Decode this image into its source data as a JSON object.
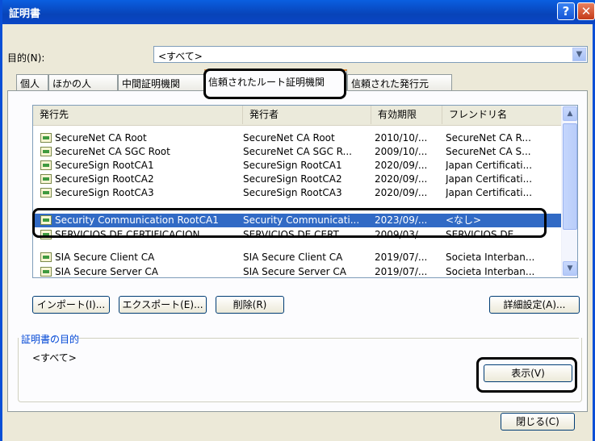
{
  "window": {
    "title": "証明書",
    "help_glyph": "?",
    "close_glyph": "✕"
  },
  "purpose": {
    "label": "目的(N):",
    "value": "<すべて>"
  },
  "tabs": [
    {
      "label": "個人"
    },
    {
      "label": "ほかの人"
    },
    {
      "label": "中間証明機関"
    },
    {
      "label": "信頼されたルート証明機関"
    },
    {
      "label": "信頼された発行元"
    }
  ],
  "list": {
    "columns": [
      "発行先",
      "発行者",
      "有効期限",
      "フレンドリ名"
    ],
    "rows": [
      {
        "issued_to": "SecureNet CA Root",
        "issued_by": "SecureNet CA Root",
        "expires": "2010/10/...",
        "friendly": "SecureNet CA R..."
      },
      {
        "issued_to": "SecureNet CA SGC Root",
        "issued_by": "SecureNet CA SGC R...",
        "expires": "2009/10/...",
        "friendly": "SecureNet CA S..."
      },
      {
        "issued_to": "SecureSign RootCA1",
        "issued_by": "SecureSign RootCA1",
        "expires": "2020/09/...",
        "friendly": "Japan Certificati..."
      },
      {
        "issued_to": "SecureSign RootCA2",
        "issued_by": "SecureSign RootCA2",
        "expires": "2020/09/...",
        "friendly": "Japan Certificati..."
      },
      {
        "issued_to": "SecureSign RootCA3",
        "issued_by": "SecureSign RootCA3",
        "expires": "2020/09/...",
        "friendly": "Japan Certificati..."
      },
      {
        "issued_to": "Security Communication RootCA1",
        "issued_by": "Security Communicati...",
        "expires": "2023/09/...",
        "friendly": "<なし>"
      },
      {
        "issued_to": "SERVICIOS DE CERTIFICACION...",
        "issued_by": "SERVICIOS DE CERT...",
        "expires": "2009/03/...",
        "friendly": "SERVICIOS DE ..."
      },
      {
        "issued_to": "SIA Secure Client CA",
        "issued_by": "SIA Secure Client CA",
        "expires": "2019/07/...",
        "friendly": "Societa Interban..."
      },
      {
        "issued_to": "SIA Secure Server CA",
        "issued_by": "SIA Secure Server CA",
        "expires": "2019/07/...",
        "friendly": "Societa Interban..."
      }
    ]
  },
  "buttons": {
    "import": "インポート(I)...",
    "export": "エクスポート(E)...",
    "delete": "削除(R)",
    "advanced": "詳細設定(A)...",
    "view": "表示(V)",
    "close": "閉じる(C)"
  },
  "group": {
    "label": "証明書の目的",
    "value": "<すべて>"
  },
  "colors": {
    "selection": "#316ac5",
    "titlebar": "#0a46c6",
    "group_label": "#0046d5"
  }
}
